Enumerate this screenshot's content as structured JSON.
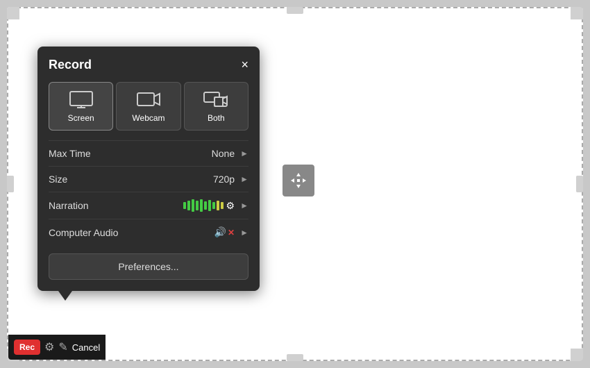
{
  "panel": {
    "title": "Record",
    "close_label": "×",
    "modes": [
      {
        "id": "screen",
        "label": "Screen",
        "active": true
      },
      {
        "id": "webcam",
        "label": "Webcam",
        "active": false
      },
      {
        "id": "both",
        "label": "Both",
        "active": false
      }
    ],
    "settings": [
      {
        "label": "Max Time",
        "value": "None"
      },
      {
        "label": "Size",
        "value": "720p"
      },
      {
        "label": "Narration",
        "value": ""
      },
      {
        "label": "Computer Audio",
        "value": ""
      }
    ],
    "preferences_label": "Preferences..."
  },
  "toolbar": {
    "rec_label": "Rec",
    "cancel_label": "Cancel"
  }
}
